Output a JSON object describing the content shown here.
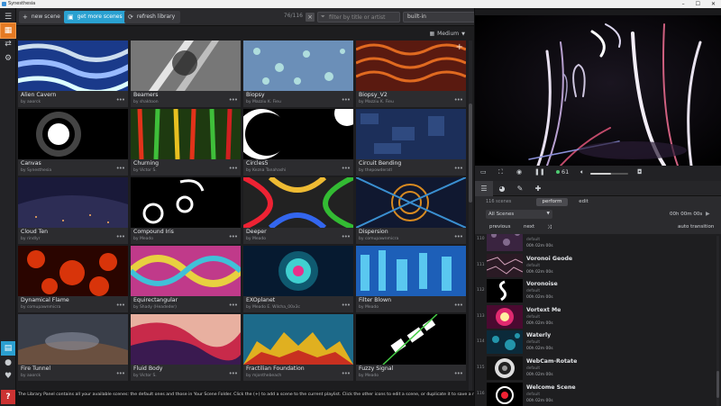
{
  "window": {
    "title": "Synesthesia",
    "controls": [
      "–",
      "☐",
      "✕"
    ]
  },
  "sidebar": {
    "items": [
      {
        "name": "menu-icon",
        "glyph": "☰"
      },
      {
        "name": "library-grid-icon",
        "glyph": "▦"
      },
      {
        "name": "share-icon",
        "glyph": "⇄"
      },
      {
        "name": "gear-icon",
        "glyph": "⚙"
      }
    ],
    "bottom": [
      {
        "name": "playlist-panel-icon",
        "glyph": "▤"
      },
      {
        "name": "user-icon",
        "glyph": "●"
      },
      {
        "name": "heart-icon",
        "glyph": "♥"
      },
      {
        "name": "help-icon",
        "glyph": "?"
      }
    ]
  },
  "toolbar": {
    "new_scene": "new scene",
    "get_more": "get more scenes",
    "refresh": "refresh library",
    "count": "76/116",
    "clear": "×",
    "search_placeholder": "filter by title or artist",
    "source": "built-in"
  },
  "library": {
    "size": "Medium",
    "scenes": [
      {
        "name": "Alien Cavern",
        "author": "by aaorck"
      },
      {
        "name": "Beamers",
        "author": "by shaktoon"
      },
      {
        "name": "Biopsy",
        "author": "by Mazziu K. Fieu"
      },
      {
        "name": "Biopsy_V2",
        "author": "by Mazziu K. Fieu"
      },
      {
        "name": "Canvas",
        "author": "by Synesthesia"
      },
      {
        "name": "Churning",
        "author": "by Victor S."
      },
      {
        "name": "Circles5",
        "author": "by Kezna Tanahashi"
      },
      {
        "name": "Circuit Bending",
        "author": "by thepowderatl"
      },
      {
        "name": "Cloud Ten",
        "author": "by rindlyr"
      },
      {
        "name": "Compound Iris",
        "author": "by Meado"
      },
      {
        "name": "Deeper",
        "author": "by Meado"
      },
      {
        "name": "Dispersion",
        "author": "by comupawnmicra"
      },
      {
        "name": "Dynamical Flame",
        "author": "by comupawnmicra"
      },
      {
        "name": "Equirectangular",
        "author": "by Shady (Headeder)"
      },
      {
        "name": "EXOplanet",
        "author": "by Meado E. Wilcha_00x3c"
      },
      {
        "name": "Filter Blown",
        "author": "by Meado"
      },
      {
        "name": "Fire Tunnel",
        "author": "by aaorck"
      },
      {
        "name": "Fluid Body",
        "author": "by Victor S."
      },
      {
        "name": "Fractilian Foundation",
        "author": "by mjonthebeach"
      },
      {
        "name": "Fuzzy Signal",
        "author": "by Meado"
      }
    ],
    "more_glyph": "•••",
    "add_glyph": "+"
  },
  "status": "The Library Panel contains all your available scenes: the default ones and those in Your Scene Folder. Click the (+) to add a scene to the current playlist. Click the other icons to edit a scene, or duplicate it to save a new version.",
  "preview_toolbar": {
    "fps": "61"
  },
  "controls": {
    "volume_level": 0.55
  },
  "playlist": {
    "scene_count": "116 scenes",
    "modes": [
      "perform",
      "edit"
    ],
    "active_mode": "perform",
    "filter": "All Scenes",
    "total_time": "00h 00m 00s",
    "previous": "previous",
    "next": "next",
    "auto_transition": "auto transition",
    "rows": [
      {
        "num": "110",
        "name": "",
        "sub": "default",
        "dur": "00h 02m 00s"
      },
      {
        "num": "111",
        "name": "Voronoi Geode",
        "sub": "default",
        "dur": "00h 02m 00s"
      },
      {
        "num": "112",
        "name": "Voronoise",
        "sub": "default",
        "dur": "00h 02m 00s"
      },
      {
        "num": "113",
        "name": "Vortext Me",
        "sub": "default",
        "dur": "00h 02m 00s"
      },
      {
        "num": "114",
        "name": "Waterly",
        "sub": "default",
        "dur": "00h 02m 00s"
      },
      {
        "num": "115",
        "name": "WebCam-Rotate",
        "sub": "default",
        "dur": "00h 02m 00s"
      },
      {
        "num": "116",
        "name": "Welcome Scene",
        "sub": "default",
        "dur": "00h 02m 00s"
      }
    ]
  },
  "colors": {
    "accent": "#2aa1d1",
    "active_tab": "#e57a23",
    "fps_ok": "#4ecb71"
  }
}
